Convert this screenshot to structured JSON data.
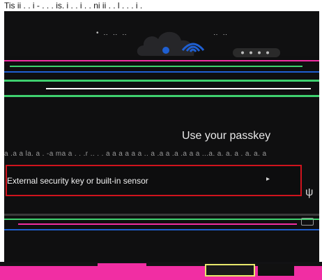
{
  "top_strip": {
    "text": "Tis ii  .   .  i   -  .  .   .  is.   i  .  .  i  .   . ni ii  .   . l  .  .   .  i  ."
  },
  "dialog": {
    "title": "Use your passkey",
    "noise_line": "a .a a la. a . -a ma a . . .r .. . . a a a a a a .. a .a a .a .a a a ...a. a. a. a . a. a. a",
    "option_label": "External security key or built-in sensor",
    "chevron": "▸",
    "usb_glyph": "ψ"
  },
  "colors": {
    "dialog_bg": "#0f0f10",
    "highlight_border": "#d0141d",
    "accent_pink": "#f12ea3",
    "accent_blue": "#1f5fd1",
    "accent_green": "#3fd06f",
    "accent_yellow": "#e8e86c"
  },
  "icons": {
    "hero": "cloud-icon",
    "wifi": "wifi-icon",
    "usb": "usb-icon",
    "key": "security-key-icon",
    "chevron": "chevron-right-icon"
  }
}
